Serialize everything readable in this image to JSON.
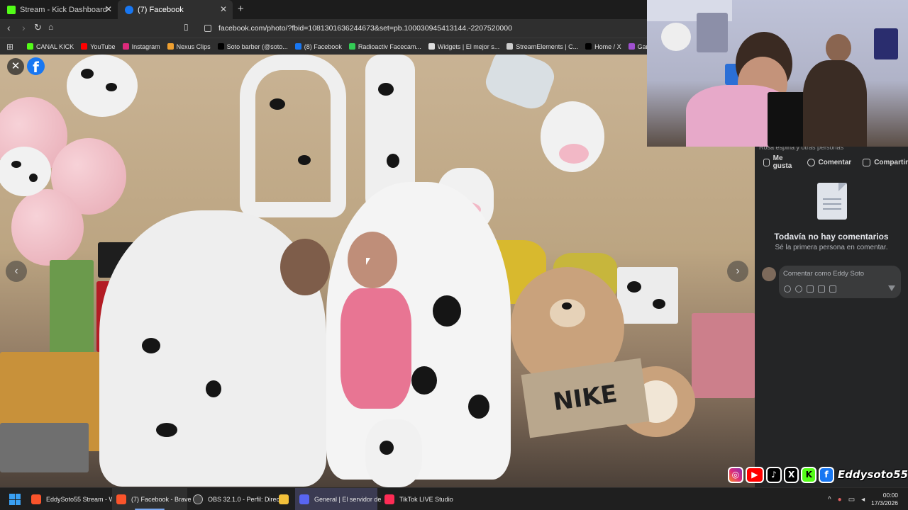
{
  "browser": {
    "tabs": [
      {
        "title": "Stream - Kick Dashboard",
        "icon": "kick-icon",
        "active": false
      },
      {
        "title": "(7) Facebook",
        "icon": "facebook-icon",
        "active": true
      }
    ],
    "url": "facebook.com/photo/?fbid=1081301636244673&set=pb.100030945413144.-2207520000",
    "bookmarks": [
      {
        "label": "CANAL KICK",
        "color": "#53fc18"
      },
      {
        "label": "YouTube",
        "color": "#ff0000"
      },
      {
        "label": "Instagram",
        "color": "#dd2a7b"
      },
      {
        "label": "Nexus Clips",
        "color": "#f0a030"
      },
      {
        "label": "Soto barber (@soto...",
        "color": "#000000"
      },
      {
        "label": "(8) Facebook",
        "color": "#1877f2"
      },
      {
        "label": "Radioactiv Facecam...",
        "color": "#33cc55"
      },
      {
        "label": "Widgets | El mejor s...",
        "color": "#dddddd"
      },
      {
        "label": "StreamElements | C...",
        "color": "#cccccc"
      },
      {
        "label": "Home / X",
        "color": "#000000"
      },
      {
        "label": "Gartic Phone - Tele...",
        "color": "#a050d0"
      }
    ]
  },
  "photo_viewer": {
    "side": {
      "reactions": "Rosa espina y otras personas",
      "actions": [
        "Me gusta",
        "Comentar",
        "Compartir"
      ],
      "no_comments_title": "Todavía no hay comentarios",
      "no_comments_sub": "Sé la primera persona en comentar.",
      "comment_placeholder": "Comentar como Eddy Soto"
    },
    "sign_text": "NIKE"
  },
  "overlay": {
    "handle": "Eddysoto55",
    "social_icons": [
      "instagram-icon",
      "youtube-icon",
      "tiktok-icon",
      "x-icon",
      "kick-icon",
      "facebook-icon"
    ]
  },
  "taskbar": {
    "items": [
      {
        "label": "EddySoto55 Stream - W",
        "color": "#fb542b"
      },
      {
        "label": "(7) Facebook - Brave",
        "color": "#fb542b"
      },
      {
        "label": "OBS 32.1.0 - Perfil: Direc",
        "color": "#444444"
      },
      {
        "label": "",
        "color": "#f3c13a"
      },
      {
        "label": "General | El servidor de",
        "color": "#5865f2"
      },
      {
        "label": "TikTok LIVE Studio",
        "color": "#fe2c55"
      }
    ],
    "time": "00:00",
    "date": "17/3/2026"
  }
}
